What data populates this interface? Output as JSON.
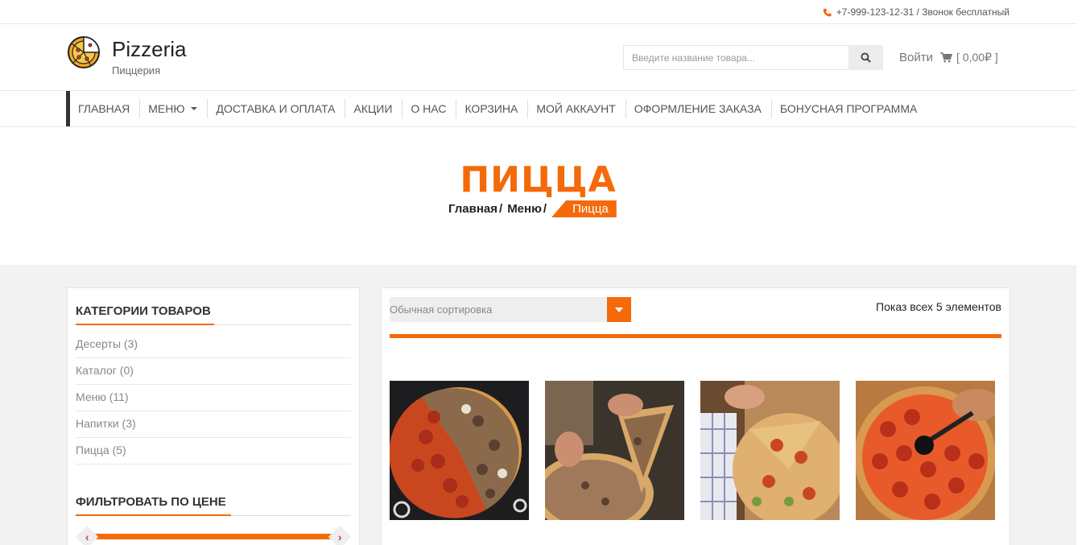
{
  "topbar": {
    "phone": "+7-999-123-12-31 / Звонок бесплатный"
  },
  "header": {
    "brand": "Pizzeria",
    "tagline": "Пиццерия",
    "search_placeholder": "Введите название товара...",
    "login": "Войти",
    "cart": "[ 0,00₽ ]"
  },
  "nav": {
    "items": [
      "ГЛАВНАЯ",
      "МЕНЮ",
      "ДОСТАВКА И ОПЛАТА",
      "АКЦИИ",
      "О НАС",
      "КОРЗИНА",
      "МОЙ АККАУНТ",
      "ОФОРМЛЕНИЕ ЗАКАЗА",
      "БОНУСНАЯ ПРОГРАММА"
    ]
  },
  "hero": {
    "title": "ПИЦЦА",
    "breadcrumb": [
      "Главная",
      "Меню",
      "Пицца"
    ],
    "separator": "/"
  },
  "sidebar": {
    "categories_title": "КАТЕГОРИИ ТОВАРОВ",
    "categories": [
      "Десерты (3)",
      "Каталог (0)",
      "Меню (11)",
      "Напитки (3)",
      "Пицца (5)"
    ],
    "filter_title": "ФИЛЬТРОВАТЬ ПО ЦЕНЕ"
  },
  "main": {
    "sort_label": "Обычная сортировка",
    "result_count": "Показ всех 5 элементов"
  },
  "colors": {
    "accent": "#f46a0a",
    "content_bg": "#f2f2f2"
  }
}
